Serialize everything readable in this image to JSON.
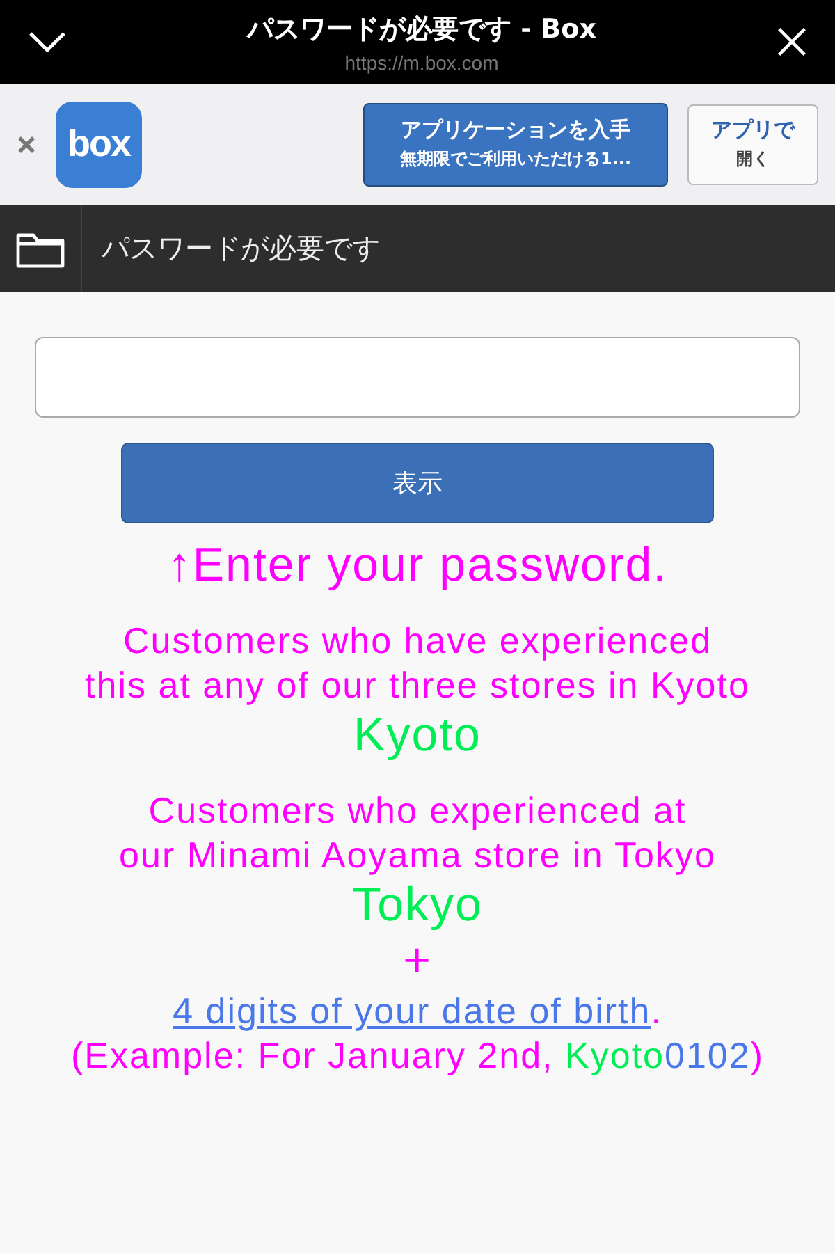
{
  "browser_bar": {
    "title": "パスワードが必要です - Box",
    "url": "https://m.box.com"
  },
  "app_banner": {
    "logo_text": "box",
    "get_button": {
      "title": "アプリケーションを入手",
      "subtitle": "無期限でご利用いただける1..."
    },
    "open_button": {
      "title": "アプリで",
      "subtitle": "開く"
    }
  },
  "header": {
    "title": "パスワードが必要です"
  },
  "form": {
    "submit_label": "表示"
  },
  "message": [
    {
      "lines": [
        {
          "kind": "large",
          "segments": [
            {
              "kind": "text",
              "text": "↑Enter your password.",
              "color": "#ff00ff"
            }
          ]
        }
      ]
    },
    {
      "lines": [
        {
          "kind": "body",
          "segments": [
            {
              "kind": "text",
              "text": "Customers who have experienced",
              "color": "#ff00ff"
            }
          ]
        },
        {
          "kind": "body",
          "segments": [
            {
              "kind": "text",
              "text": "this at any of our three stores in Kyoto",
              "color": "#ff00ff"
            }
          ]
        },
        {
          "kind": "large",
          "segments": [
            {
              "kind": "text",
              "text": "Kyoto",
              "color": "#00ee55"
            }
          ]
        }
      ]
    },
    {
      "lines": [
        {
          "kind": "body",
          "segments": [
            {
              "kind": "text",
              "text": "Customers who experienced at",
              "color": "#ff00ff"
            }
          ]
        },
        {
          "kind": "body",
          "segments": [
            {
              "kind": "text",
              "text": "our Minami Aoyama store in Tokyo",
              "color": "#ff00ff"
            }
          ]
        },
        {
          "kind": "large",
          "segments": [
            {
              "kind": "text",
              "text": "Tokyo",
              "color": "#00ee55"
            }
          ]
        },
        {
          "kind": "large",
          "segments": [
            {
              "kind": "text",
              "text": "+",
              "color": "#ff00ff"
            }
          ]
        },
        {
          "kind": "body",
          "segments": [
            {
              "kind": "link",
              "text": "4 digits of your date of birth",
              "color": "#4a78e8"
            },
            {
              "kind": "text",
              "text": ".",
              "color": "#ff00ff"
            }
          ]
        },
        {
          "kind": "body",
          "segments": [
            {
              "kind": "text",
              "text": "(Example: For January 2nd, ",
              "color": "#ff00ff"
            },
            {
              "kind": "text",
              "text": "Kyoto",
              "color": "#00ee55"
            },
            {
              "kind": "text",
              "text": "0102",
              "color": "#4a78e8"
            },
            {
              "kind": "text",
              "text": ")",
              "color": "#ff00ff"
            }
          ]
        }
      ]
    }
  ]
}
